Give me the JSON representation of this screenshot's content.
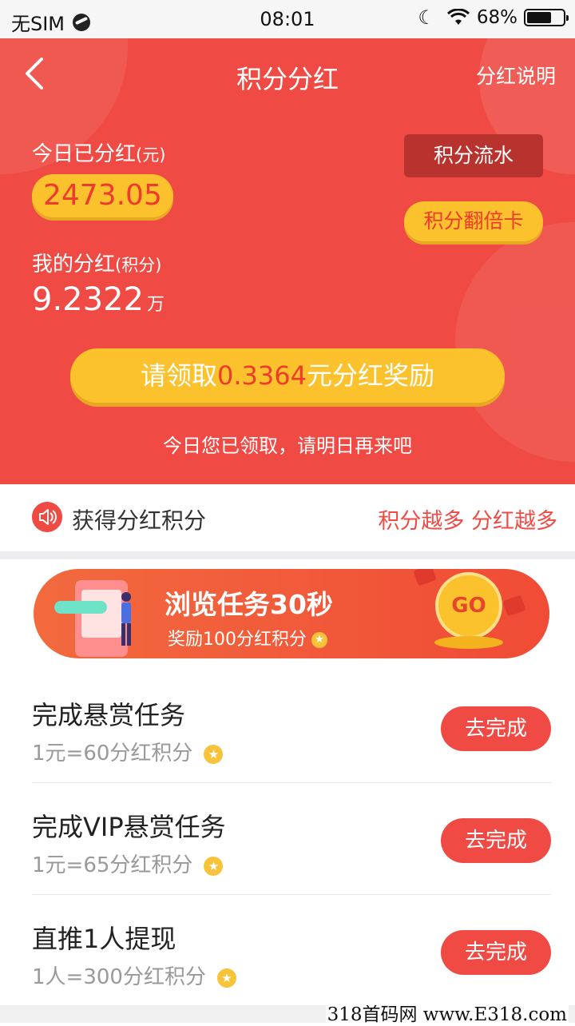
{
  "status_bar": {
    "carrier": "无SIM",
    "time": "08:01",
    "battery": "68%",
    "battery_level": 0.68
  },
  "nav": {
    "title": "积分分红",
    "help_link": "分红说明"
  },
  "summary": {
    "today_label": "今日已分红",
    "today_unit": "(元)",
    "today_amount": "2473.05",
    "my_label": "我的分红",
    "my_unit": "(积分)",
    "my_value": "9.2322",
    "my_value_unit": "万",
    "flow_button": "积分流水",
    "double_card_button": "积分翻倍卡"
  },
  "claim": {
    "prefix": "请领取",
    "amount": "0.3364",
    "suffix": "元分红奖励",
    "note": "今日您已领取，请明日再来吧"
  },
  "earn": {
    "title": "获得分红积分",
    "slogan": "积分越多 分红越多"
  },
  "banner": {
    "title": "浏览任务30秒",
    "subtitle": "奖励100分红积分",
    "go_label": "GO"
  },
  "tasks": [
    {
      "title": "完成悬赏任务",
      "reward": "1元=60分红积分",
      "button": "去完成"
    },
    {
      "title": "完成VIP悬赏任务",
      "reward": "1元=65分红积分",
      "button": "去完成"
    },
    {
      "title": "直推1人提现",
      "reward": "1人=300分红积分",
      "button": "去完成"
    }
  ],
  "watermark": "318首码网 www.E318.com",
  "colors": {
    "primary_red": "#ef4b44",
    "gold": "#fbc22d",
    "dark_red": "#b8332e"
  }
}
